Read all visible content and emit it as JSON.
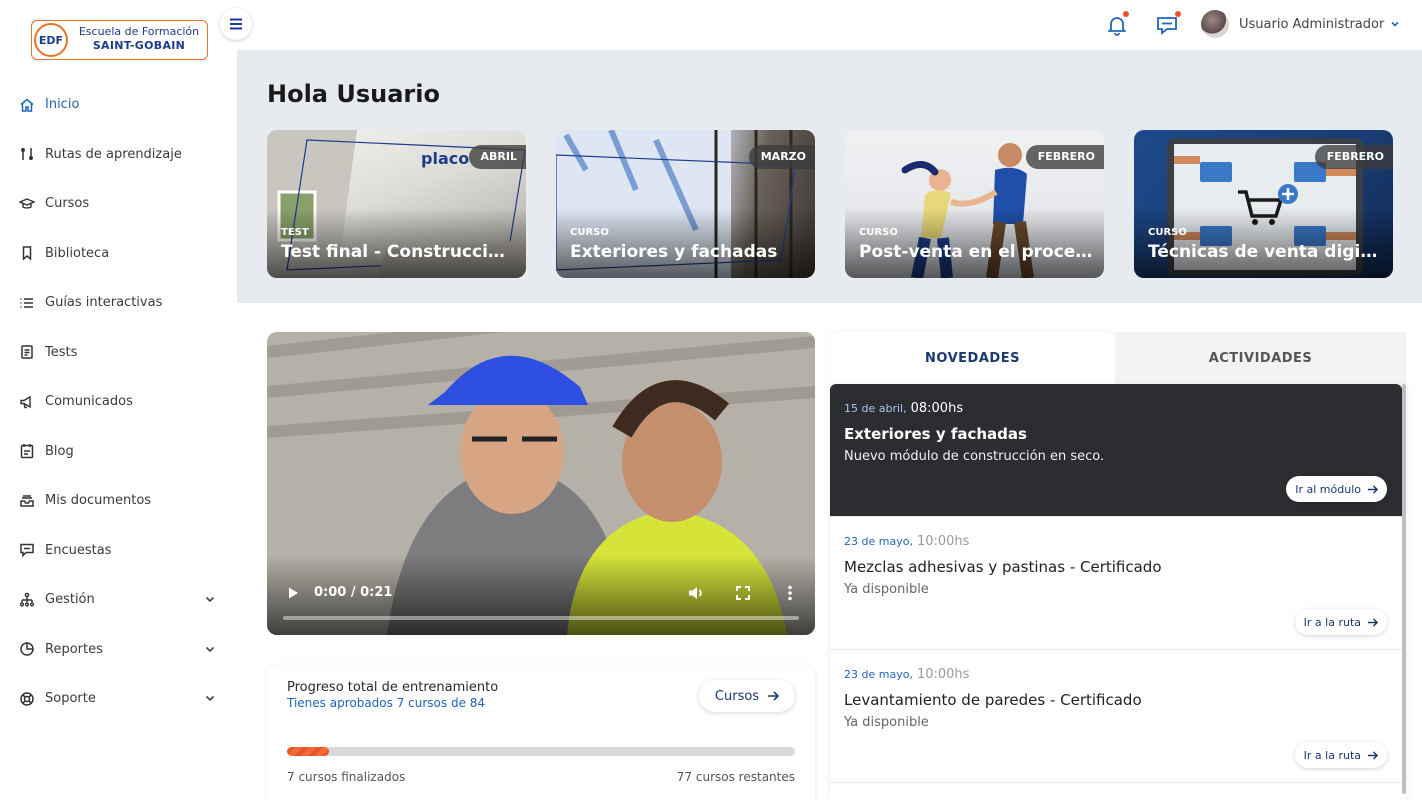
{
  "logo": {
    "abbr": "EDF",
    "line1": "Escuela de Formación",
    "line2": "SAINT-GOBAIN"
  },
  "sidebar": {
    "items": [
      {
        "label": "Inicio",
        "icon": "home-icon",
        "active": true
      },
      {
        "label": "Rutas de aprendizaje",
        "icon": "route-icon"
      },
      {
        "label": "Cursos",
        "icon": "graduation-cap-icon"
      },
      {
        "label": "Biblioteca",
        "icon": "bookmark-icon"
      },
      {
        "label": "Guías interactivas",
        "icon": "list-icon"
      },
      {
        "label": "Tests",
        "icon": "clipboard-icon"
      },
      {
        "label": "Comunicados",
        "icon": "megaphone-icon"
      },
      {
        "label": "Blog",
        "icon": "notepad-icon"
      },
      {
        "label": "Mis documentos",
        "icon": "inbox-icon"
      },
      {
        "label": "Encuestas",
        "icon": "chat-icon"
      },
      {
        "label": "Gestión",
        "icon": "org-chart-icon",
        "expandable": true
      },
      {
        "label": "Reportes",
        "icon": "pie-chart-icon",
        "expandable": true
      },
      {
        "label": "Soporte",
        "icon": "lifebuoy-icon",
        "expandable": true
      }
    ]
  },
  "topbar": {
    "user_name": "Usuario Administrador"
  },
  "hero": {
    "greeting": "Hola Usuario",
    "cards": [
      {
        "month": "ABRIL",
        "type": "TEST",
        "title": "Test final - Construcción en seco"
      },
      {
        "month": "MARZO",
        "type": "CURSO",
        "title": "Exteriores y fachadas"
      },
      {
        "month": "FEBRERO",
        "type": "CURSO",
        "title": "Post-venta en el proceso comercial"
      },
      {
        "month": "FEBRERO",
        "type": "CURSO",
        "title": "Técnicas de venta digital"
      }
    ],
    "card1_brand": "placo"
  },
  "video": {
    "time": "0:00 / 0:21"
  },
  "progress": {
    "title": "Progreso total de entrenamiento",
    "subtitle": "Tienes aprobados 7 cursos de 84",
    "button_label": "Cursos",
    "completed_label": "7 cursos finalizados",
    "remaining_label": "77 cursos restantes",
    "fraction": 0.083
  },
  "panel": {
    "tabs": [
      "NOVEDADES",
      "ACTIVIDADES"
    ],
    "news": [
      {
        "date": "15 de abril",
        "time": "08:00hs",
        "title": "Exteriores y fachadas",
        "subtitle": "Nuevo módulo de construcción en seco.",
        "button": "Ir al módulo",
        "style": "dark"
      },
      {
        "date": "23 de mayo",
        "time": "10:00hs",
        "title": "Mezclas adhesivas y pastinas - Certificado",
        "subtitle": "Ya disponible",
        "button": "Ir a la ruta",
        "style": "light"
      },
      {
        "date": "23 de mayo",
        "time": "10:00hs",
        "title": "Levantamiento de paredes - Certificado",
        "subtitle": "Ya disponible",
        "button": "Ir a la ruta",
        "style": "light"
      }
    ]
  },
  "colors": {
    "accent": "#1f66b8",
    "brand_orange": "#e8542a",
    "dark_card": "#2b2d31"
  }
}
